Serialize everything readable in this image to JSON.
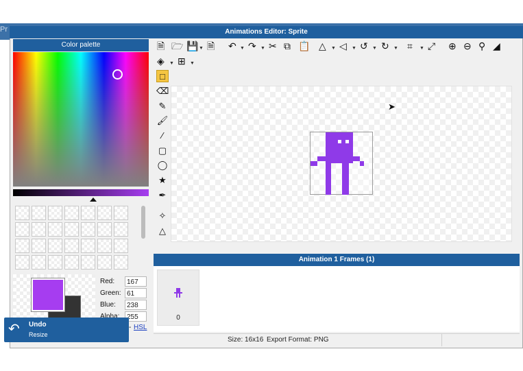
{
  "app": {
    "background_title": "Pr",
    "window_title": "Animations Editor: Sprite"
  },
  "palette": {
    "header": "Color palette",
    "primary_color": "#a63df0",
    "secondary_color": "#333333",
    "rgb": {
      "red_label": "Red:",
      "red": "167",
      "green_label": "Green:",
      "green": "61",
      "blue_label": "Blue:",
      "blue": "238",
      "alpha_label": "Alpha:",
      "alpha": "255"
    },
    "hsl_link": "HSL",
    "hsl_sep": "-"
  },
  "toolbar": {
    "icons": [
      "new-file-icon",
      "open-folder-icon",
      "save-icon",
      "export-icon",
      "undo-icon",
      "redo-icon",
      "cut-icon",
      "copy-icon",
      "paste-icon",
      "flip-horizontal-icon",
      "flip-vertical-icon",
      "rotate-left-icon",
      "rotate-right-icon",
      "crop-icon",
      "resize-icon",
      "zoom-in-icon",
      "zoom-out-icon",
      "zoom-fit-icon",
      "fill-view-icon",
      "layers-icon",
      "grid-icon"
    ]
  },
  "tools": [
    "select-rect-icon",
    "eraser-icon",
    "pencil-icon",
    "brush-icon",
    "line-icon",
    "rectangle-icon",
    "ellipse-icon",
    "bucket-fill-icon",
    "eyedropper-icon",
    "move-icon",
    "transform-icon"
  ],
  "frames": {
    "header": "Animation 1 Frames (1)",
    "items": [
      {
        "index": "0"
      }
    ]
  },
  "status": {
    "size": "Size: 16x16",
    "export_format": "Export Format: PNG"
  },
  "toast": {
    "title": "Undo",
    "subtitle": "Resize"
  },
  "colors": {
    "titlebar": "#1f5f9e",
    "sprite": "#8f3ae8",
    "accent_tool": "#f5c542"
  }
}
